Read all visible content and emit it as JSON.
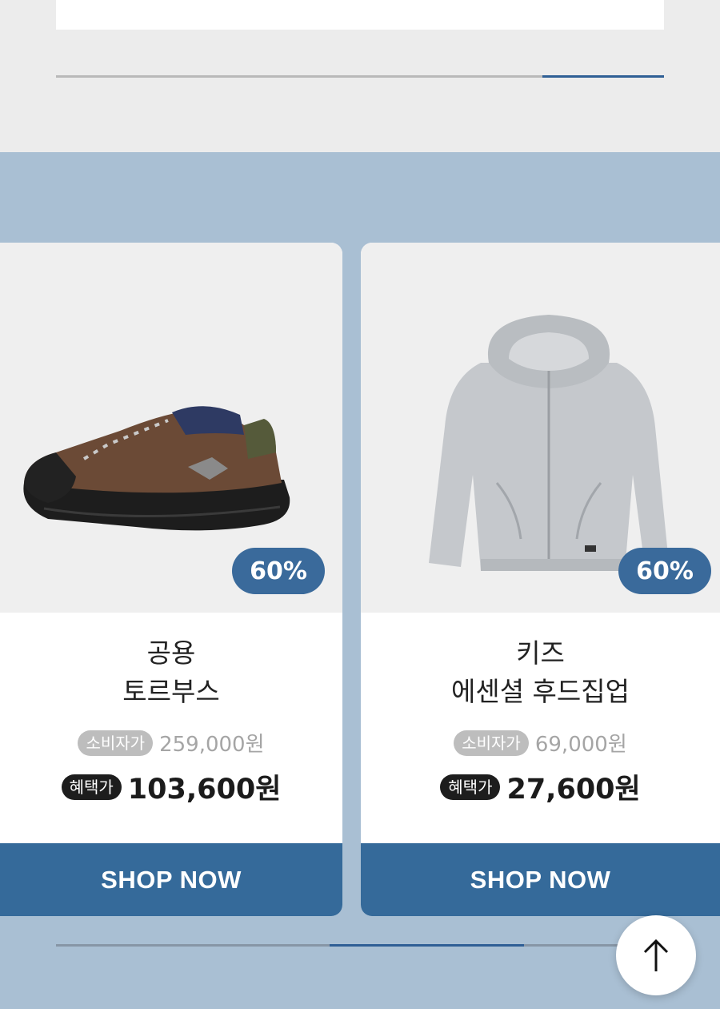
{
  "top_progress": {
    "position_fraction": 0.8,
    "fill_fraction": 0.2
  },
  "products": [
    {
      "name_line1": "공용",
      "name_line2": "토르부스",
      "discount": "60%",
      "msrp_label": "소비자가",
      "msrp_price": "259,000원",
      "sale_label": "혜택가",
      "sale_price": "103,600원",
      "button_label": "SHOP NOW",
      "image": "brown-hiking-shoe"
    },
    {
      "name_line1": "키즈",
      "name_line2": "에센셜 후드집업",
      "discount": "60%",
      "msrp_label": "소비자가",
      "msrp_price": "69,000원",
      "sale_label": "혜택가",
      "sale_price": "27,600원",
      "button_label": "SHOP NOW",
      "image": "grey-zip-hoodie"
    }
  ],
  "bottom_progress": {
    "position_fraction": 0.45,
    "fill_fraction": 0.32
  },
  "scroll_top_icon": "arrow-up-icon",
  "colors": {
    "accent": "#356a9a",
    "badge": "#3a6a9b",
    "background": "#a9bfd3"
  }
}
